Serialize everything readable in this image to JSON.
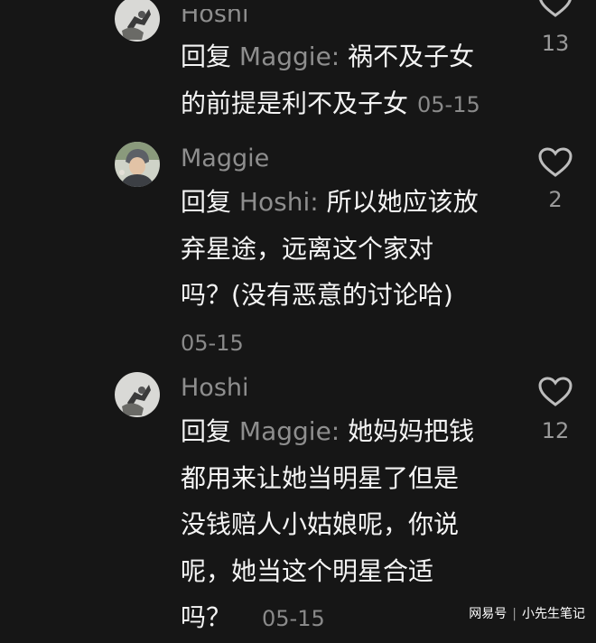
{
  "comments": [
    {
      "username": "Hoshi",
      "reply_tag": "回复",
      "reply_target": "Maggie:",
      "lines": [
        "祸不及子女",
        "的前提是利不及子女"
      ],
      "date": "05-15",
      "likes": "13",
      "icon": "heart-icon"
    },
    {
      "username": "Maggie",
      "reply_tag": "回复",
      "reply_target": "Hoshi:",
      "lines": [
        "所以她应该放",
        "弃星途，远离这个家对",
        "吗？(没有恶意的讨论哈)"
      ],
      "date": "05-15",
      "likes": "2",
      "icon": "heart-icon"
    },
    {
      "username": "Hoshi",
      "reply_tag": "回复",
      "reply_target": "Maggie:",
      "lines": [
        "她妈妈把钱",
        "都用来让她当明星了但是",
        "没钱赔人小姑娘呢，你说",
        "呢，她当这个明星合适",
        "吗？"
      ],
      "date": "05-15",
      "likes": "12",
      "icon": "heart-icon"
    }
  ],
  "watermark": {
    "source": "网易号",
    "separator": "|",
    "author": "小先生笔记"
  }
}
